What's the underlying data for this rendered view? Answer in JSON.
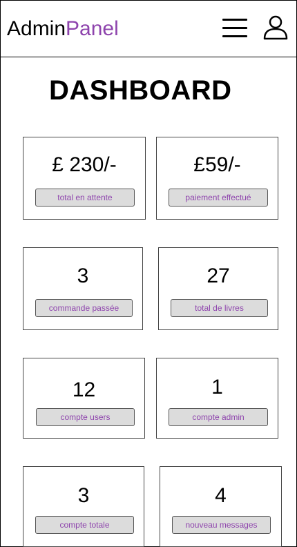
{
  "header": {
    "brand_part1": "Admin",
    "brand_part2": "Panel",
    "accent_color": "#8e44ad"
  },
  "page": {
    "title": "DASHBOARD"
  },
  "cards": [
    {
      "value": "£ 230/-",
      "label": "total en attente"
    },
    {
      "value": "£59/-",
      "label": "paiement effectué"
    },
    {
      "value": "3",
      "label": "commande passée"
    },
    {
      "value": "27",
      "label": "total de livres"
    },
    {
      "value": "12",
      "label": "compte users"
    },
    {
      "value": "1",
      "label": "compte admin"
    },
    {
      "value": "3",
      "label": "compte totale"
    },
    {
      "value": "4",
      "label": "nouveau messages"
    }
  ],
  "icons": {
    "menu": "hamburger-menu-icon",
    "user": "user-profile-icon"
  }
}
